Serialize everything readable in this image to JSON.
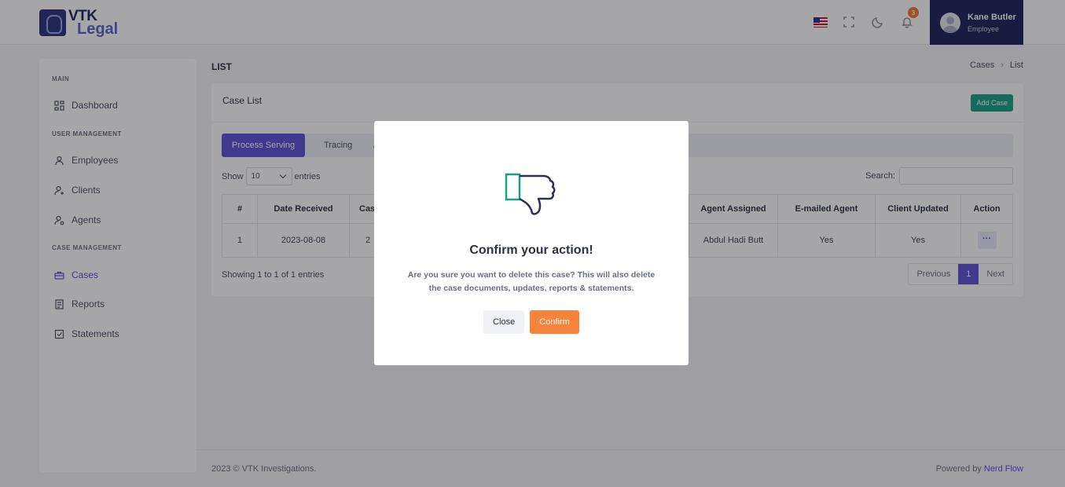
{
  "brand": {
    "line1": "VTK",
    "line2": "Legal"
  },
  "header": {
    "notifications": "3",
    "user_name": "Kane Butler",
    "user_role": "Employee"
  },
  "sidebar": {
    "sections": [
      "MAIN",
      "USER MANAGEMENT",
      "CASE MANAGEMENT"
    ],
    "items": [
      {
        "label": "Dashboard",
        "icon": "dashboard-icon"
      },
      {
        "label": "Employees",
        "icon": "user-icon"
      },
      {
        "label": "Clients",
        "icon": "user-plus-icon"
      },
      {
        "label": "Agents",
        "icon": "user-gear-icon"
      },
      {
        "label": "Cases",
        "icon": "briefcase-icon",
        "active": true
      },
      {
        "label": "Reports",
        "icon": "report-icon"
      },
      {
        "label": "Statements",
        "icon": "statement-icon"
      }
    ]
  },
  "page": {
    "title": "LIST",
    "breadcrumb": [
      "Cases",
      "List"
    ]
  },
  "card": {
    "title": "Case List",
    "add_button": "Add Case",
    "tabs": [
      "Process Serving",
      "Tracing",
      "As"
    ],
    "show_label": "Show",
    "entries_value": "10",
    "entries_label": "entries",
    "search_label": "Search:",
    "columns": [
      "#",
      "Date Received",
      "Cas",
      "Agent Assigned",
      "E-mailed Agent",
      "Client Updated",
      "Action"
    ],
    "rows": [
      {
        "num": "1",
        "date": "2023-08-08",
        "case": "2",
        "agent": "Abdul Hadi Butt",
        "emailed": "Yes",
        "updated": "Yes",
        "action": "···"
      }
    ],
    "showing": "Showing 1 to 1 of 1 entries",
    "pager": {
      "prev": "Previous",
      "page": "1",
      "next": "Next"
    }
  },
  "footer": {
    "left": "2023 © VTK Investigations.",
    "powered": "Powered by",
    "link": "Nerd Flow"
  },
  "modal": {
    "title": "Confirm your action!",
    "message": "Are you sure you want to delete this case? This will also delete the case documents, updates, reports & statements.",
    "close": "Close",
    "confirm": "Confirm",
    "icon": "thumbs-down-icon"
  },
  "colors": {
    "primary": "#5b4fd6",
    "accent": "#17a085",
    "confirm": "#f5833b",
    "navy": "#1c2059"
  }
}
